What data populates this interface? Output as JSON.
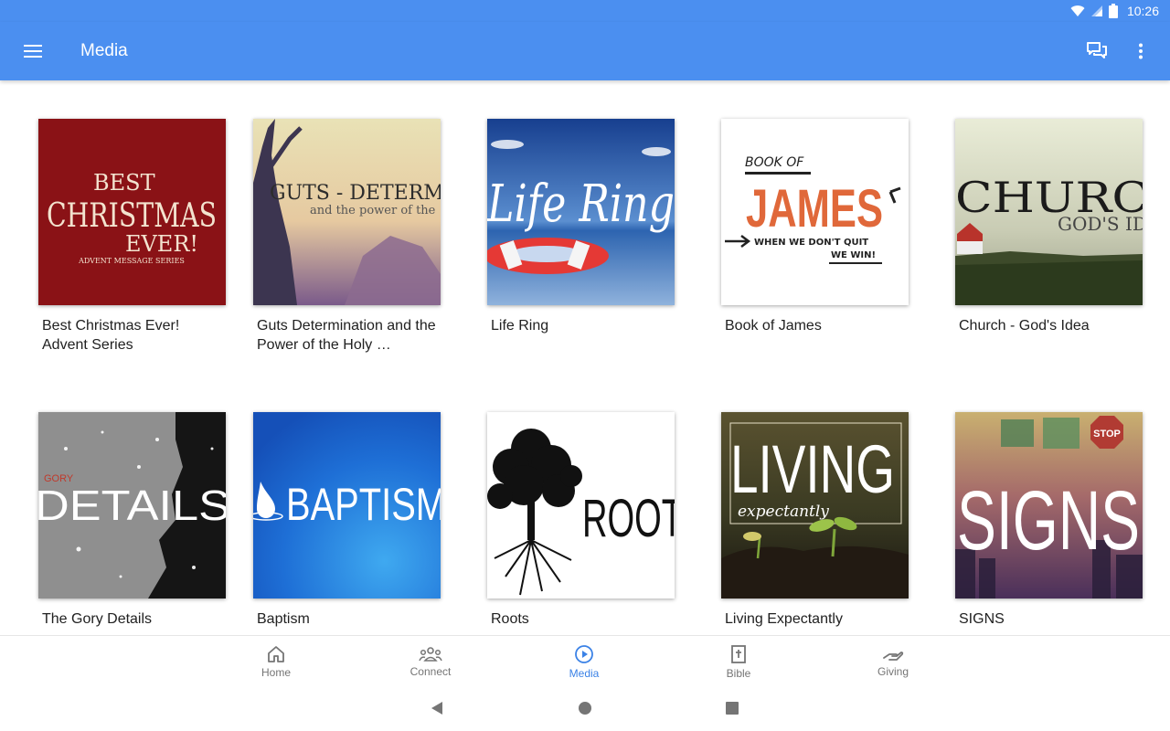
{
  "status": {
    "time": "10:26"
  },
  "header": {
    "title": "Media"
  },
  "colors": {
    "primary": "#4b8ff0",
    "active": "#3b82e6",
    "inactive": "#757575"
  },
  "media": {
    "items": [
      {
        "title": "Best Christmas Ever! Advent Series",
        "art": {
          "line1": "BEST",
          "line2": "CHRISTMAS",
          "line3": "EVER!",
          "line4": "ADVENT MESSAGE SERIES"
        }
      },
      {
        "title": "Guts Determination and the Power of the Holy …",
        "art": {
          "line1": "GUTS - DETERMINA",
          "line2": "and the power of the"
        }
      },
      {
        "title": "Life Ring",
        "art": {
          "line1": "Life Ring"
        }
      },
      {
        "title": "Book of James",
        "art": {
          "line1": "BOOK OF",
          "line2": "JAMES",
          "line3": "WHEN WE DON'T QUIT",
          "line4": "WE WIN!"
        }
      },
      {
        "title": "Church - God's Idea",
        "art": {
          "line1": "CHURC",
          "line2": "GOD'S ID"
        }
      },
      {
        "title": "The Gory Details",
        "art": {
          "line1": "GORY",
          "line2": "DETAILS"
        }
      },
      {
        "title": "Baptism",
        "art": {
          "line1": "BAPTISM"
        }
      },
      {
        "title": "Roots",
        "art": {
          "line1": "ROOT"
        }
      },
      {
        "title": "Living Expectantly",
        "art": {
          "line1": "LIVING",
          "line2": "expectantly"
        }
      },
      {
        "title": "SIGNS",
        "art": {
          "line1": "SIGNS",
          "line2": "STOP"
        }
      }
    ]
  },
  "nav": {
    "items": [
      {
        "label": "Home",
        "icon": "home-icon"
      },
      {
        "label": "Connect",
        "icon": "group-icon"
      },
      {
        "label": "Media",
        "icon": "play-circle-icon",
        "active": true
      },
      {
        "label": "Bible",
        "icon": "bible-icon"
      },
      {
        "label": "Giving",
        "icon": "giving-hand-icon"
      }
    ]
  }
}
